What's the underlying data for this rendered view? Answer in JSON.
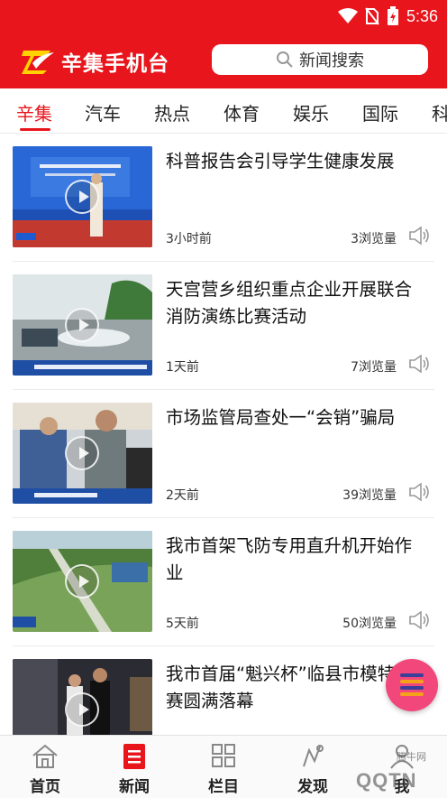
{
  "status_bar": {
    "time": "5:36"
  },
  "header": {
    "app_title": "辛集手机台",
    "search_label": "新闻搜索"
  },
  "tabs": [
    {
      "label": "辛集",
      "active": true
    },
    {
      "label": "汽车"
    },
    {
      "label": "热点"
    },
    {
      "label": "体育"
    },
    {
      "label": "娱乐"
    },
    {
      "label": "国际"
    },
    {
      "label": "科"
    }
  ],
  "news": [
    {
      "title": "科普报告会引导学生健康发展",
      "time": "3小时前",
      "views": "3浏览量"
    },
    {
      "title": "天宫营乡组织重点企业开展联合消防演练比赛活动",
      "time": "1天前",
      "views": "7浏览量"
    },
    {
      "title": "市场监管局查处一“会销”骗局",
      "time": "2天前",
      "views": "39浏览量"
    },
    {
      "title": "我市首架飞防专用直升机开始作业",
      "time": "5天前",
      "views": "50浏览量"
    },
    {
      "title": "我市首届“魁兴杯”临县市模特大赛圆满落幕",
      "time": "",
      "views": ""
    }
  ],
  "bottom_nav": [
    {
      "label": "首页",
      "icon": "home-icon"
    },
    {
      "label": "新闻",
      "icon": "news-icon",
      "active": true
    },
    {
      "label": "栏目",
      "icon": "grid-icon"
    },
    {
      "label": "发现",
      "icon": "discover-icon"
    },
    {
      "label": "我",
      "icon": "user-icon"
    }
  ],
  "watermark": {
    "text": "QQTN",
    "small": "腾牛网"
  },
  "colors": {
    "brand_red": "#e8161c",
    "fab_pink": "#f2477b"
  }
}
